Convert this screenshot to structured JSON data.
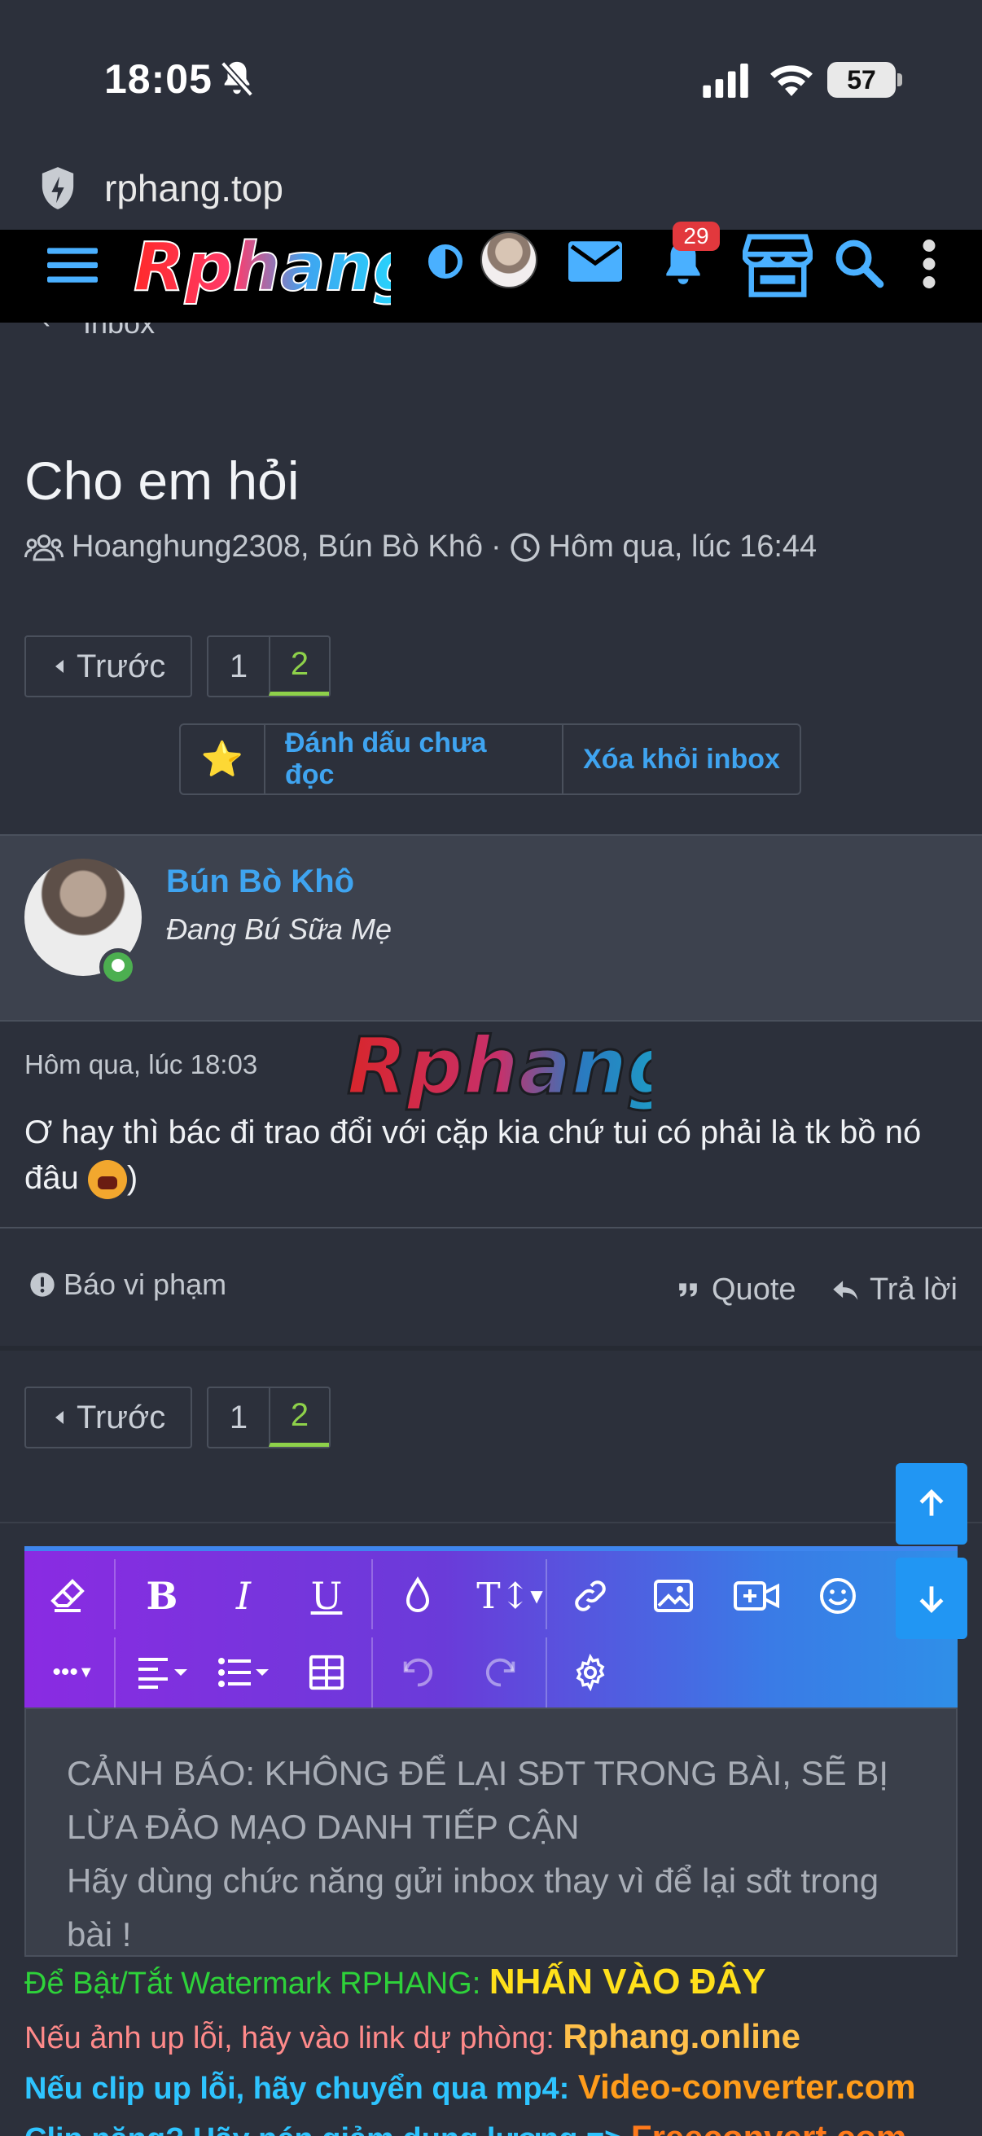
{
  "status_bar": {
    "time": "18:05",
    "battery": "57"
  },
  "browser": {
    "url": "rphang.top"
  },
  "site": {
    "logo": "Rphang",
    "notification_count": "29"
  },
  "breadcrumb": {
    "label": "Inbox"
  },
  "conversation": {
    "title": "Cho em hỏi",
    "participants": "Hoanghung2308, Bún Bò Khô",
    "separator": "·",
    "date": "Hôm qua, lúc 16:44"
  },
  "pagination": {
    "prev_label": "Trước",
    "pages": [
      "1",
      "2"
    ],
    "current": "2"
  },
  "actions": {
    "star": "⭐",
    "mark_unread": "Đánh dấu chưa đọc",
    "leave": "Xóa khỏi inbox"
  },
  "message": {
    "author": "Bún Bò Khô",
    "user_title": "Đang Bú Sữa Mẹ",
    "date": "Hôm qua, lúc 18:03",
    "watermark": "Rphang",
    "text": "Ơ hay thì bác đi trao đổi với cặp kia chứ tui có phải là tk bồ nó đâu",
    "text_tail": ")",
    "report_label": "Báo vi phạm",
    "quote_label": "Quote",
    "reply_label": "Trả lời"
  },
  "editor": {
    "placeholder_line1": "CẢNH BÁO: KHÔNG ĐỂ LẠI SĐT TRONG BÀI, SẼ BỊ LỪA ĐẢO MẠO DANH TIẾP CẬN",
    "placeholder_line2": "Hãy dùng chức năng gửi inbox thay vì để lại sđt trong bài !"
  },
  "promo": {
    "line1_text": "Để Bật/Tắt Watermark RPHANG: ",
    "line1_link": "NHẤN VÀO ĐÂY",
    "line2_text": "Nếu ảnh up lỗi, hãy vào link dự phòng: ",
    "line2_link": "Rphang.online",
    "line3_text": "Nếu clip up lỗi, hãy chuyển qua mp4: ",
    "line3_link": "Video-converter.com",
    "line4_text": "Clip nặng? Hãy nén giảm dung lượng => ",
    "line4_link": "Freeconvert.com"
  },
  "colors": {
    "accent": "#3fa4f0",
    "active_page": "#8ed14a",
    "online": "#4caf50",
    "badge": "#e2383d"
  }
}
